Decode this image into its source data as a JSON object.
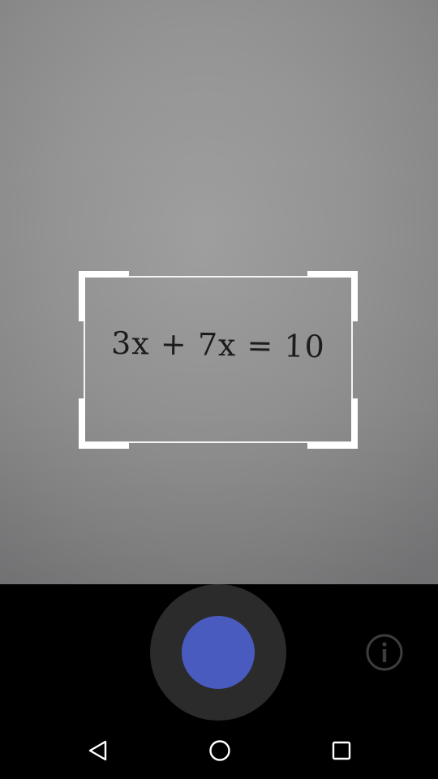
{
  "viewfinder": {
    "equation_text": "3x + 7x = 10"
  },
  "controls": {
    "shutter_icon": "shutter-button",
    "info_icon": "info-icon",
    "accent_color": "#4a5bc0"
  },
  "navbar": {
    "back_icon": "back-triangle-icon",
    "home_icon": "home-circle-icon",
    "recents_icon": "recents-square-icon"
  }
}
